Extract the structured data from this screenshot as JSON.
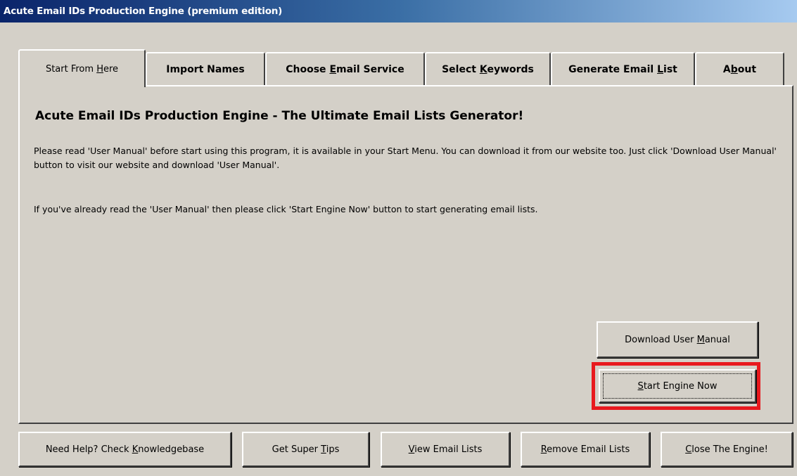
{
  "window": {
    "title": "Acute Email IDs Production Engine (premium edition)"
  },
  "tabs": [
    {
      "label_pre": "Start From ",
      "label_key": "H",
      "label_post": "ere",
      "active": true
    },
    {
      "label_pre": "Import Names",
      "label_key": "",
      "label_post": "",
      "active": false
    },
    {
      "label_pre": "Choose ",
      "label_key": "E",
      "label_post": "mail Service",
      "active": false
    },
    {
      "label_pre": "Select ",
      "label_key": "K",
      "label_post": "eywords",
      "active": false
    },
    {
      "label_pre": "Generate Email ",
      "label_key": "L",
      "label_post": "ist",
      "active": false
    },
    {
      "label_pre": "A",
      "label_key": "b",
      "label_post": "out",
      "active": false
    }
  ],
  "main": {
    "heading": "Acute Email IDs Production Engine - The Ultimate Email Lists Generator!",
    "paragraph1": "Please read 'User Manual' before start using this program, it is available in your Start Menu. You can download it from our website too. Just click 'Download User Manual' button to visit our website and download 'User Manual'.",
    "paragraph2": "If you've already read the 'User Manual' then please click 'Start Engine Now' button to start generating email lists.",
    "download_btn": {
      "pre": "Download User ",
      "key": "M",
      "post": "anual"
    },
    "start_btn": {
      "pre": "",
      "key": "S",
      "post": "tart Engine Now"
    }
  },
  "footer": {
    "buttons": [
      {
        "pre": "Need Help? Check ",
        "key": "K",
        "post": "nowledgebase"
      },
      {
        "pre": "Get Super ",
        "key": "T",
        "post": "ips"
      },
      {
        "pre": "",
        "key": "V",
        "post": "iew Email Lists"
      },
      {
        "pre": "",
        "key": "R",
        "post": "emove Email Lists"
      },
      {
        "pre": "",
        "key": "C",
        "post": "lose The Engine!"
      }
    ]
  },
  "colors": {
    "highlight": "#e8191e",
    "titlebar_start": "#0a246a",
    "titlebar_end": "#a6caf0",
    "face": "#d4d0c8"
  }
}
